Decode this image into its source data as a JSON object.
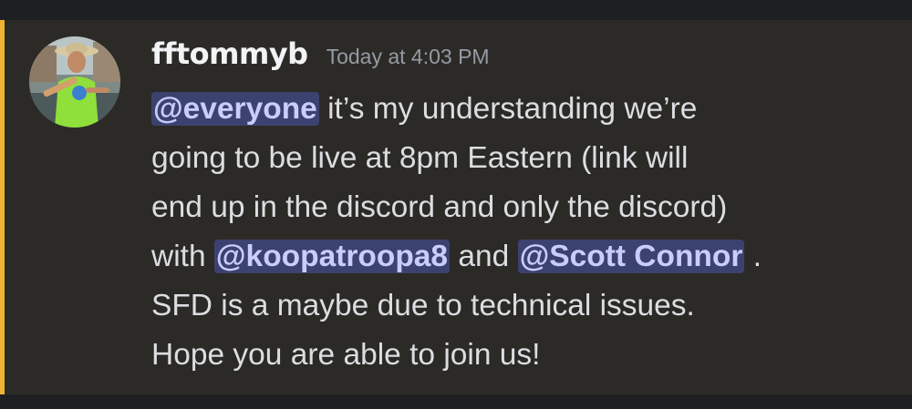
{
  "colors": {
    "background": "#1e1f22",
    "message_highlight": "#2c2a26",
    "mention_accent_bar": "#f0b232",
    "mention_bg": "#3c4270",
    "mention_text": "#c9cdfb",
    "username": "#f2f3f5",
    "timestamp": "#949ba4",
    "message_text": "#dbdee1"
  },
  "message": {
    "avatar_icon": "user-avatar",
    "author": "fftommyb",
    "timestamp": "Today at 4:03 PM",
    "lines": {
      "l1_mention": "@everyone",
      "l1_text": " it’s my understanding we’re",
      "l2_text": "going to be live at 8pm Eastern (link will",
      "l3_text": "end up in the discord and only the discord)",
      "l4_pre": "with ",
      "l4_mention1": "@koopatroopa8",
      "l4_mid": " and ",
      "l4_mention2": "@Scott Connor",
      "l4_post": " .",
      "l5_text": "SFD is a maybe due to technical issues.",
      "l6_text": "Hope you are able to join us!"
    }
  }
}
